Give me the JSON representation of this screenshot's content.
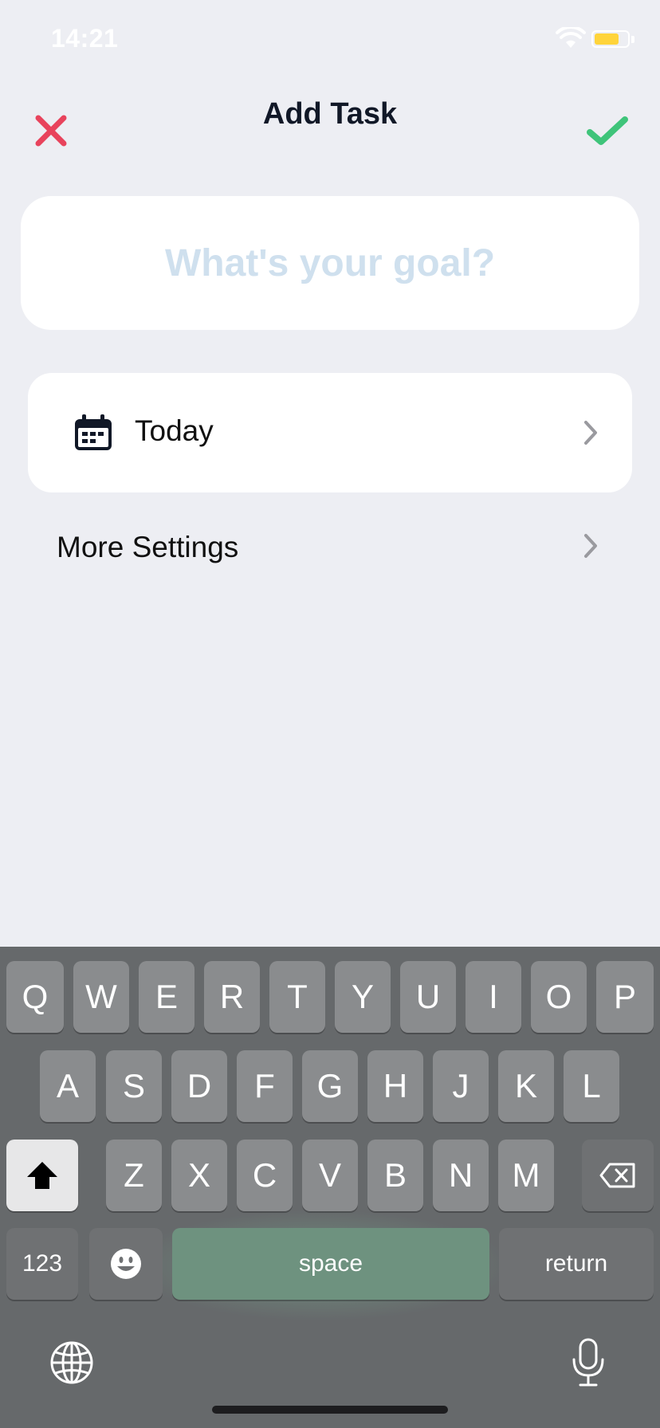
{
  "status_bar": {
    "time": "14:21",
    "battery_color": "#FFD43B",
    "battery_level": 0.75
  },
  "header": {
    "title": "Add Task",
    "close_icon": "x-mark-icon",
    "close_color": "#E8435C",
    "confirm_icon": "check-mark-icon",
    "confirm_color": "#3FC47A"
  },
  "goal": {
    "value": "",
    "placeholder": "What's your goal?"
  },
  "date_row": {
    "icon": "calendar-icon",
    "label": "Today"
  },
  "more_settings": {
    "label": "More Settings"
  },
  "keyboard": {
    "row1": [
      "Q",
      "W",
      "E",
      "R",
      "T",
      "Y",
      "U",
      "I",
      "O",
      "P"
    ],
    "row2": [
      "A",
      "S",
      "D",
      "F",
      "G",
      "H",
      "J",
      "K",
      "L"
    ],
    "row3": [
      "Z",
      "X",
      "C",
      "V",
      "B",
      "N",
      "M"
    ],
    "numbers_label": "123",
    "space_label": "space",
    "return_label": "return",
    "shift_icon": "shift-arrow-icon",
    "delete_icon": "backspace-icon",
    "emoji_icon": "emoji-icon",
    "globe_icon": "globe-icon",
    "mic_icon": "microphone-icon"
  }
}
